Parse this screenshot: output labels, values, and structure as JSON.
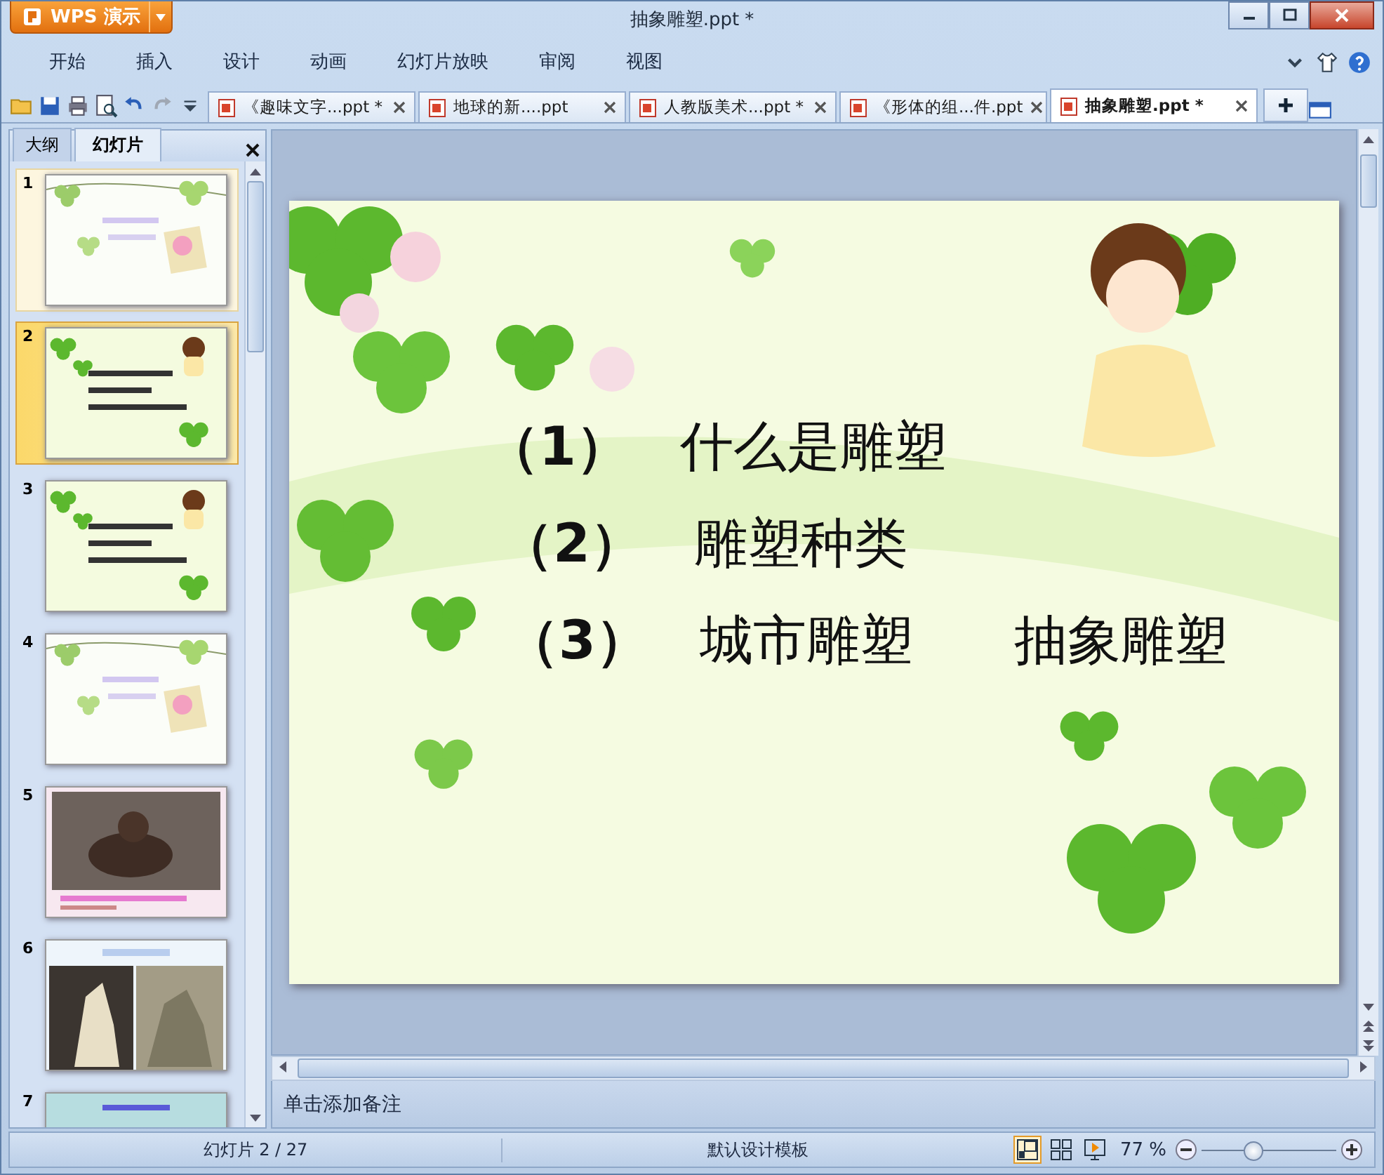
{
  "app_button": {
    "label": "WPS 演示"
  },
  "window": {
    "title": "抽象雕塑.ppt *"
  },
  "menu": [
    "开始",
    "插入",
    "设计",
    "动画",
    "幻灯片放映",
    "审阅",
    "视图"
  ],
  "doc_tabs": [
    {
      "label": "《趣味文字...ppt *",
      "selected": false
    },
    {
      "label": "地球的新....ppt",
      "selected": false
    },
    {
      "label": "人教版美术...ppt *",
      "selected": false
    },
    {
      "label": "《形体的组...件.ppt",
      "selected": false
    },
    {
      "label": "抽象雕塑.ppt *",
      "selected": true
    }
  ],
  "panel_tabs": [
    {
      "label": "大纲",
      "selected": false
    },
    {
      "label": "幻灯片",
      "selected": true
    }
  ],
  "thumbnails": [
    {
      "number": "1",
      "selected": false
    },
    {
      "number": "2",
      "selected": true
    },
    {
      "number": "3",
      "selected": false
    },
    {
      "number": "4",
      "selected": false
    },
    {
      "number": "5",
      "selected": false
    },
    {
      "number": "6",
      "selected": false
    },
    {
      "number": "7",
      "selected": false
    }
  ],
  "slide": {
    "lines": [
      [
        "（1）",
        "什么是雕塑"
      ],
      [
        "（2）",
        "雕塑种类"
      ],
      [
        "（3）",
        "城市雕塑",
        "抽象雕塑"
      ]
    ]
  },
  "notes": {
    "placeholder": "单击添加备注"
  },
  "status_bar": {
    "slide_counter": "幻灯片 2 / 27",
    "template": "默认设计模板",
    "views": [
      {
        "kind": "normal",
        "selected": true
      },
      {
        "kind": "sorter",
        "selected": false
      },
      {
        "kind": "show",
        "selected": false
      }
    ],
    "zoom": "77 %",
    "zoom_slider": {
      "level": 0.38
    }
  }
}
